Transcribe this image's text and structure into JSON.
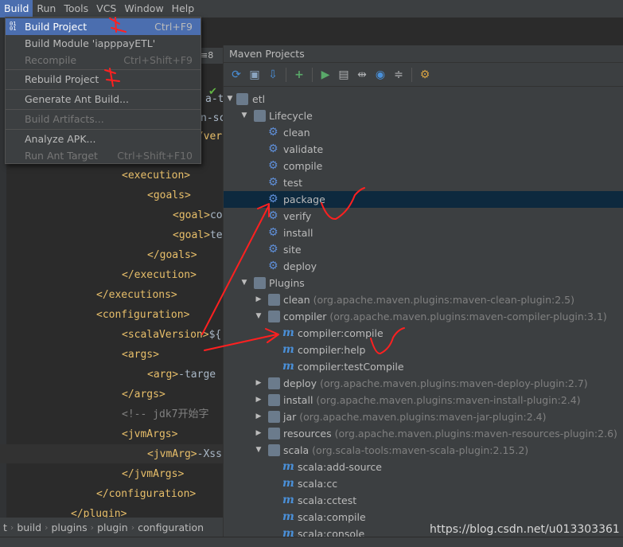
{
  "menubar": {
    "items": [
      "Build",
      "Run",
      "Tools",
      "VCS",
      "Window",
      "Help"
    ]
  },
  "build_menu": {
    "build_project": {
      "label": "Build Project",
      "shortcut": "Ctrl+F9"
    },
    "build_module": {
      "label": "Build Module 'iapppayETL'"
    },
    "recompile": {
      "label": "Recompile",
      "shortcut": "Ctrl+Shift+F9"
    },
    "rebuild_project": {
      "label": "Rebuild Project"
    },
    "generate_ant": {
      "label": "Generate Ant Build..."
    },
    "build_artifacts": {
      "label": "Build Artifacts..."
    },
    "analyze_apk": {
      "label": "Analyze APK..."
    },
    "run_ant_target": {
      "label": "Run Ant Target",
      "shortcut": "Ctrl+Shift+F10"
    }
  },
  "editor": {
    "lines": [
      {
        "tag": "<execution>"
      },
      {
        "tag": "<goals>"
      },
      {
        "tag": "<goal>",
        "text": "co"
      },
      {
        "tag": "<goal>",
        "text": "te"
      },
      {
        "tag": "</goals>"
      },
      {
        "tag": "</execution>"
      },
      {
        "tag": "</executions>"
      },
      {
        "tag": "<configuration>"
      },
      {
        "tag": "<scalaVersion>",
        "text": "${"
      },
      {
        "tag": "<args>"
      },
      {
        "tag": "<arg>",
        "text": "-targe"
      },
      {
        "tag": "</args>"
      },
      {
        "comment": "<!-- jdk7开始字"
      },
      {
        "tag": "<jvmArgs>"
      },
      {
        "tag": "<jvmArg>",
        "text": "-Xss"
      },
      {
        "tag": "</jvmArgs>"
      },
      {
        "tag": "</configuration>"
      },
      {
        "tag": "</plugin>"
      }
    ],
    "fragments": [
      "a-t",
      "n-sc",
      "</ver"
    ]
  },
  "breadcrumb": [
    "t",
    "build",
    "plugins",
    "plugin",
    "configuration"
  ],
  "maven": {
    "title": "Maven Projects",
    "root": "etl",
    "lifecycle_label": "Lifecycle",
    "lifecycle": [
      "clean",
      "validate",
      "compile",
      "test",
      "package",
      "verify",
      "install",
      "site",
      "deploy"
    ],
    "plugins_label": "Plugins",
    "plugins": [
      {
        "name": "clean",
        "coord": "(org.apache.maven.plugins:maven-clean-plugin:2.5)"
      },
      {
        "name": "compiler",
        "coord": "(org.apache.maven.plugins:maven-compiler-plugin:3.1)",
        "goals": [
          "compiler:compile",
          "compiler:help",
          "compiler:testCompile"
        ]
      },
      {
        "name": "deploy",
        "coord": "(org.apache.maven.plugins:maven-deploy-plugin:2.7)"
      },
      {
        "name": "install",
        "coord": "(org.apache.maven.plugins:maven-install-plugin:2.4)"
      },
      {
        "name": "jar",
        "coord": "(org.apache.maven.plugins:maven-jar-plugin:2.4)"
      },
      {
        "name": "resources",
        "coord": "(org.apache.maven.plugins:maven-resources-plugin:2.6)"
      },
      {
        "name": "scala",
        "coord": "(org.scala-tools:maven-scala-plugin:2.15.2)",
        "goals": [
          "scala:add-source",
          "scala:cc",
          "scala:cctest",
          "scala:compile",
          "scala:console"
        ]
      }
    ]
  },
  "watermark": "https://blog.csdn.net/u013303361",
  "colors": {
    "accent": "#4b6eaf",
    "selection": "#0d293e",
    "annotation": "#ff2020"
  }
}
